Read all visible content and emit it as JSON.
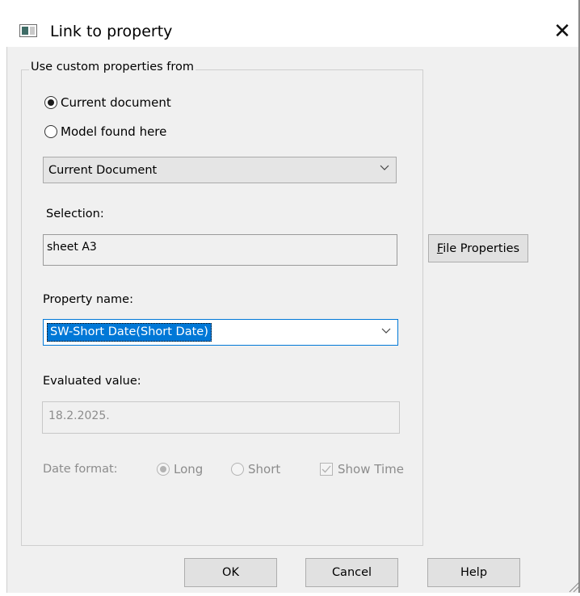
{
  "window": {
    "title": "Link to property",
    "close_glyph": "✕",
    "icon": "dialog-app-icon"
  },
  "source_group": {
    "legend": "Use custom properties from",
    "options": [
      {
        "label": "Current document",
        "selected": true
      },
      {
        "label": "Model found here",
        "selected": false
      }
    ],
    "document_combo": {
      "value": "Current Document",
      "icon": "chevron-down-icon"
    }
  },
  "selection": {
    "label": "Selection:",
    "value": "sheet A3"
  },
  "file_properties_button": {
    "label_prefix": "F",
    "label_rest": "ile Properties"
  },
  "property_name": {
    "label": "Property name:",
    "value": "SW-Short Date(Short Date)",
    "icon": "chevron-down-icon",
    "highlight_color": "#0078d7"
  },
  "evaluated_value": {
    "label": "Evaluated value:",
    "value": "18.2.2025."
  },
  "date_format": {
    "label": "Date format:",
    "options": [
      {
        "label": "Long",
        "selected": true
      },
      {
        "label": "Short",
        "selected": false
      }
    ],
    "show_time": {
      "label": "Show Time",
      "checked": true
    },
    "enabled": false
  },
  "buttons": {
    "ok": "OK",
    "cancel": "Cancel",
    "help": "Help"
  }
}
